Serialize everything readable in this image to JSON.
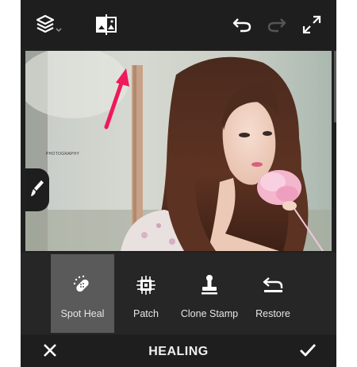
{
  "toolbar": {
    "icons": [
      "layers-icon",
      "compare-icon",
      "undo-icon",
      "redo-icon",
      "fullscreen-icon"
    ]
  },
  "canvas": {
    "watermark_text": "PHOTOGRAPHY"
  },
  "tools": [
    {
      "label": "Spot Heal",
      "icon": "bandage-icon",
      "active": true
    },
    {
      "label": "Patch",
      "icon": "patch-icon",
      "active": false
    },
    {
      "label": "Clone Stamp",
      "icon": "stamp-icon",
      "active": false
    },
    {
      "label": "Restore",
      "icon": "restore-icon",
      "active": false
    }
  ],
  "bottombar": {
    "title": "HEALING",
    "cancel_icon": "close-icon",
    "confirm_icon": "checkmark-icon"
  },
  "colors": {
    "app_background": "#202020",
    "active_tool": "#5a5a5a",
    "arrow": "#f0195a"
  }
}
